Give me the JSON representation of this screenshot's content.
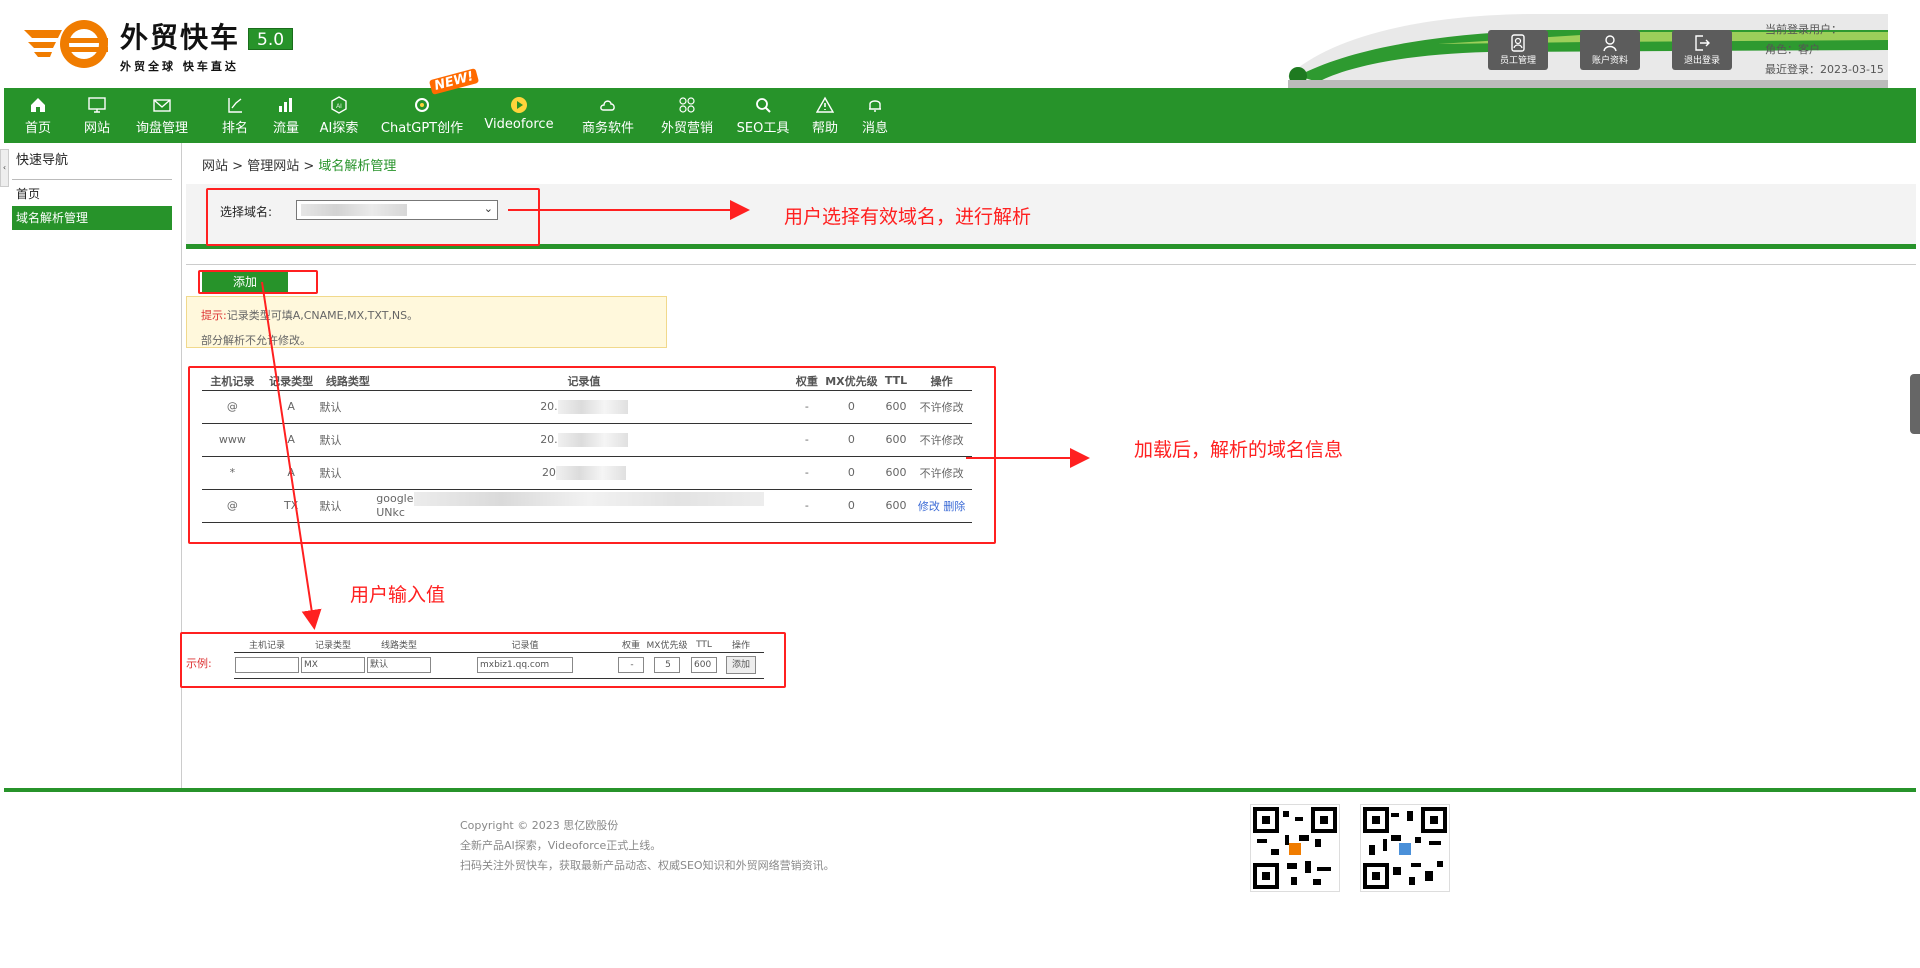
{
  "brand": {
    "title": "外贸快车",
    "subtitle": "外贸全球 快车直达",
    "version": "5.0",
    "primary_color": "#27932a",
    "orange": "#f07c00"
  },
  "header": {
    "buttons": [
      {
        "label": "员工管理",
        "icon": "staff-icon"
      },
      {
        "label": "账户资料",
        "icon": "account-icon"
      },
      {
        "label": "退出登录",
        "icon": "logout-icon"
      }
    ],
    "user": {
      "current_user": "当前登录用户：",
      "role": "角色：客户",
      "last_login": "最近登录：2023-03-15"
    }
  },
  "nav": {
    "items": [
      {
        "label": "首页",
        "icon": "home-icon"
      },
      {
        "label": "网站",
        "icon": "monitor-icon"
      },
      {
        "label": "询盘管理",
        "icon": "mail-icon"
      },
      {
        "label": "排名",
        "icon": "ranking-icon"
      },
      {
        "label": "流量",
        "icon": "bar-chart-icon"
      },
      {
        "label": "AI探索",
        "icon": "ai-icon"
      },
      {
        "label": "ChatGPT创作",
        "icon": "chatgpt-icon"
      },
      {
        "label": "Videoforce",
        "icon": "video-icon"
      },
      {
        "label": "商务软件",
        "icon": "cloud-icon"
      },
      {
        "label": "外贸营销",
        "icon": "apps-icon"
      },
      {
        "label": "SEO工具",
        "icon": "search-icon"
      },
      {
        "label": "帮助",
        "icon": "warning-icon"
      },
      {
        "label": "消息",
        "icon": "bell-icon"
      }
    ],
    "new_badge": "NEW!"
  },
  "sidebar": {
    "title": "快速导航",
    "items": [
      {
        "label": "首页"
      },
      {
        "label": "域名解析管理"
      }
    ]
  },
  "breadcrumb": {
    "part1": "网站",
    "sep": " > ",
    "part2": "管理网站",
    "current": "域名解析管理"
  },
  "domain_select": {
    "label": "选择域名:"
  },
  "add_button": "添加",
  "tips": {
    "label": "提示:",
    "line1": "记录类型可填A,CNAME,MX,TXT,NS。",
    "line2": "部分解析不允许修改。"
  },
  "records": {
    "headers": [
      "主机记录",
      "记录类型",
      "线路类型",
      "记录值",
      "权重",
      "MX优先级",
      "TTL",
      "操作"
    ],
    "rows": [
      {
        "host": "@",
        "type": "A",
        "line": "默认",
        "value": "20.",
        "weight": "-",
        "mx": "0",
        "ttl": "600",
        "op": "不许修改"
      },
      {
        "host": "www",
        "type": "A",
        "line": "默认",
        "value": "20.",
        "weight": "-",
        "mx": "0",
        "ttl": "600",
        "op": "不许修改"
      },
      {
        "host": "*",
        "type": "A",
        "line": "默认",
        "value": "20",
        "weight": "-",
        "mx": "0",
        "ttl": "600",
        "op": "不许修改"
      },
      {
        "host": "@",
        "type": "TX",
        "line": "默认",
        "value": "google",
        "value_end": "UNkc",
        "weight": "-",
        "mx": "0",
        "ttl": "600",
        "op_edit": "修改",
        "op_delete": "删除"
      }
    ]
  },
  "example": {
    "label": "示例:",
    "headers": [
      "主机记录",
      "记录类型",
      "线路类型",
      "记录值",
      "权重",
      "MX优先级",
      "TTL",
      "操作"
    ],
    "host": "",
    "type": "MX",
    "line": "默认",
    "value": "mxbiz1.qq.com",
    "weight": "-",
    "mx": "5",
    "ttl": "600",
    "button": "添加"
  },
  "annotations": {
    "select_domain": "用户选择有效域名，进行解析",
    "loaded_info": "加载后，解析的域名信息",
    "user_input": "用户输入值"
  },
  "footer": {
    "copyright": "Copyright © 2023 思亿欧股份",
    "line2": "全新产品AI探索，Videoforce正式上线。",
    "line3": "扫码关注外贸快车，获取最新产品动态、权威SEO知识和外贸网络营销资讯。"
  }
}
